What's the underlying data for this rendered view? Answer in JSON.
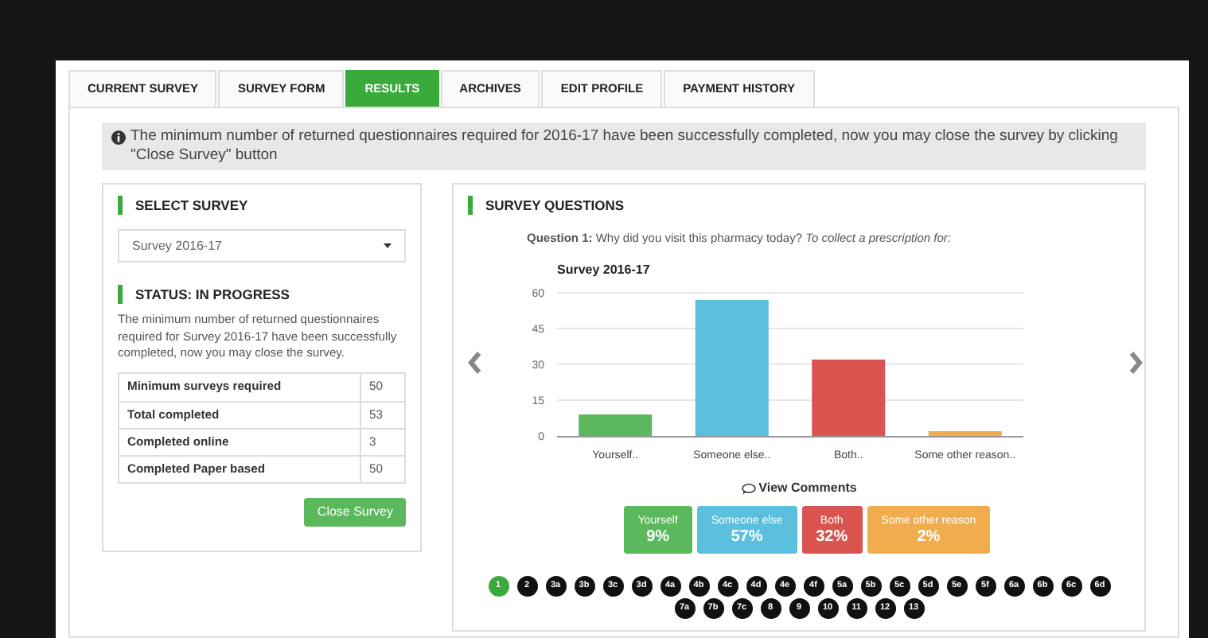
{
  "tabs": [
    {
      "label": "CURRENT SURVEY",
      "selected": false
    },
    {
      "label": "SURVEY FORM",
      "selected": false
    },
    {
      "label": "RESULTS",
      "selected": true
    },
    {
      "label": "ARCHIVES",
      "selected": false
    },
    {
      "label": "EDIT PROFILE",
      "selected": false
    },
    {
      "label": "PAYMENT HISTORY",
      "selected": false
    }
  ],
  "alert": "The minimum number of returned questionnaires required for 2016-17 have been successfully completed, now you may close the survey by clicking \"Close Survey\" button",
  "select_survey": {
    "heading": "SELECT SURVEY",
    "value": "Survey 2016-17"
  },
  "status": {
    "heading": "STATUS: IN PROGRESS",
    "text": "The minimum number of returned questionnaires required for Survey 2016-17 have been successfully completed, now you may close the survey.",
    "rows": [
      {
        "label": "Minimum surveys required",
        "value": "50"
      },
      {
        "label": "Total completed",
        "value": "53"
      },
      {
        "label": "Completed online",
        "value": "3"
      },
      {
        "label": "Completed Paper based",
        "value": "50"
      }
    ],
    "button": "Close Survey"
  },
  "survey_questions": {
    "heading": "SURVEY QUESTIONS",
    "question": "**Question 1:** Why did you visit this pharmacy today? *To collect a prescription for:*",
    "chart_data": {
      "type": "bar",
      "title": "Survey 2016-17",
      "categories": [
        "Yourself..",
        "Someone else..",
        "Both..",
        "Some other reason.."
      ],
      "values": [
        9,
        57,
        32,
        2
      ],
      "ylim": [
        0,
        60
      ],
      "yticks": [
        0,
        15,
        30,
        45,
        60
      ],
      "grid": true
    },
    "view_comments": "View Comments",
    "summary": [
      {
        "label": "Yourself",
        "percent": "9%",
        "color": "#5cb85c"
      },
      {
        "label": "Someone else",
        "percent": "57%",
        "color": "#5bc0de"
      },
      {
        "label": "Both",
        "percent": "32%",
        "color": "#d9534f"
      },
      {
        "label": "Some other reason",
        "percent": "2%",
        "color": "#f0ad4e"
      }
    ],
    "pages": [
      {
        "label": "1",
        "selected": true
      },
      {
        "label": "2",
        "selected": false
      },
      {
        "label": "3a",
        "selected": false
      },
      {
        "label": "3b",
        "selected": false
      },
      {
        "label": "3c",
        "selected": false
      },
      {
        "label": "3d",
        "selected": false
      },
      {
        "label": "4a",
        "selected": false
      },
      {
        "label": "4b",
        "selected": false
      },
      {
        "label": "4c",
        "selected": false
      },
      {
        "label": "4d",
        "selected": false
      },
      {
        "label": "4e",
        "selected": false
      },
      {
        "label": "4f",
        "selected": false
      },
      {
        "label": "5a",
        "selected": false
      },
      {
        "label": "5b",
        "selected": false
      },
      {
        "label": "5c",
        "selected": false
      },
      {
        "label": "5d",
        "selected": false
      },
      {
        "label": "5e",
        "selected": false
      },
      {
        "label": "5f",
        "selected": false
      },
      {
        "label": "6a",
        "selected": false
      },
      {
        "label": "6b",
        "selected": false
      },
      {
        "label": "6c",
        "selected": false
      },
      {
        "label": "6d",
        "selected": false
      },
      {
        "label": "7a",
        "selected": false
      },
      {
        "label": "7b",
        "selected": false
      },
      {
        "label": "7c",
        "selected": false
      },
      {
        "label": "8",
        "selected": false
      },
      {
        "label": "9",
        "selected": false
      },
      {
        "label": "10",
        "selected": false
      },
      {
        "label": "11",
        "selected": false
      },
      {
        "label": "12",
        "selected": false
      },
      {
        "label": "13",
        "selected": false
      }
    ]
  }
}
